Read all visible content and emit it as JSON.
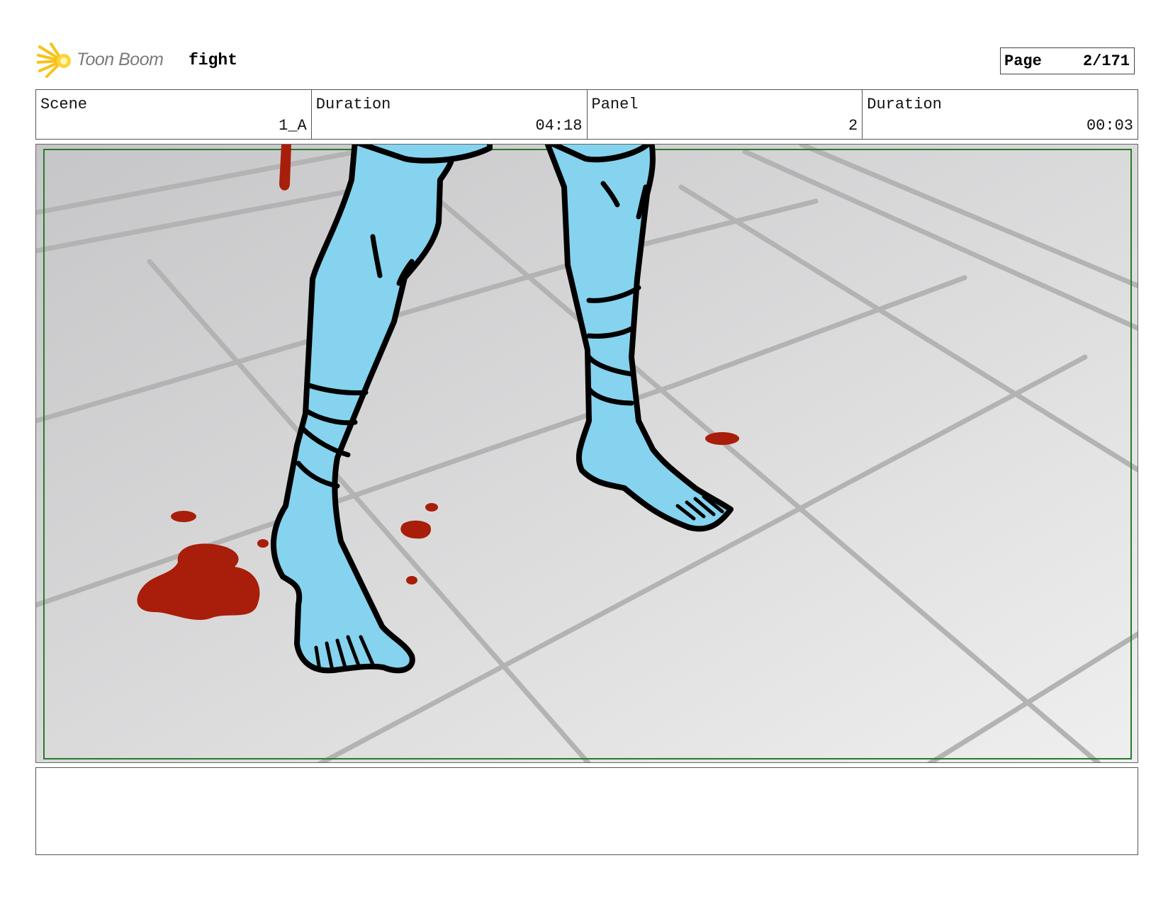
{
  "header": {
    "logo_text": "Toon Boom",
    "project_title": "fight",
    "page_label": "Page",
    "page_value": "2/171"
  },
  "info": {
    "scene_label": "Scene",
    "scene_value": "1_A",
    "scene_duration_label": "Duration",
    "scene_duration_value": "04:18",
    "panel_label": "Panel",
    "panel_value": "2",
    "panel_duration_label": "Duration",
    "panel_duration_value": "00:03"
  },
  "panel_image": {
    "subject": "Two light-blue bandaged legs and bare feet on a grey tiled floor with red blood drops",
    "colors": {
      "skin": "#85d3ee",
      "blood": "#a81e0a",
      "floor_light": "#ececec",
      "floor_dark": "#c6c6c8",
      "tile_lines": "#b3b3b3",
      "safe_frame": "#2b7a2b",
      "outline": "#000000"
    }
  },
  "notes": {
    "text": ""
  }
}
